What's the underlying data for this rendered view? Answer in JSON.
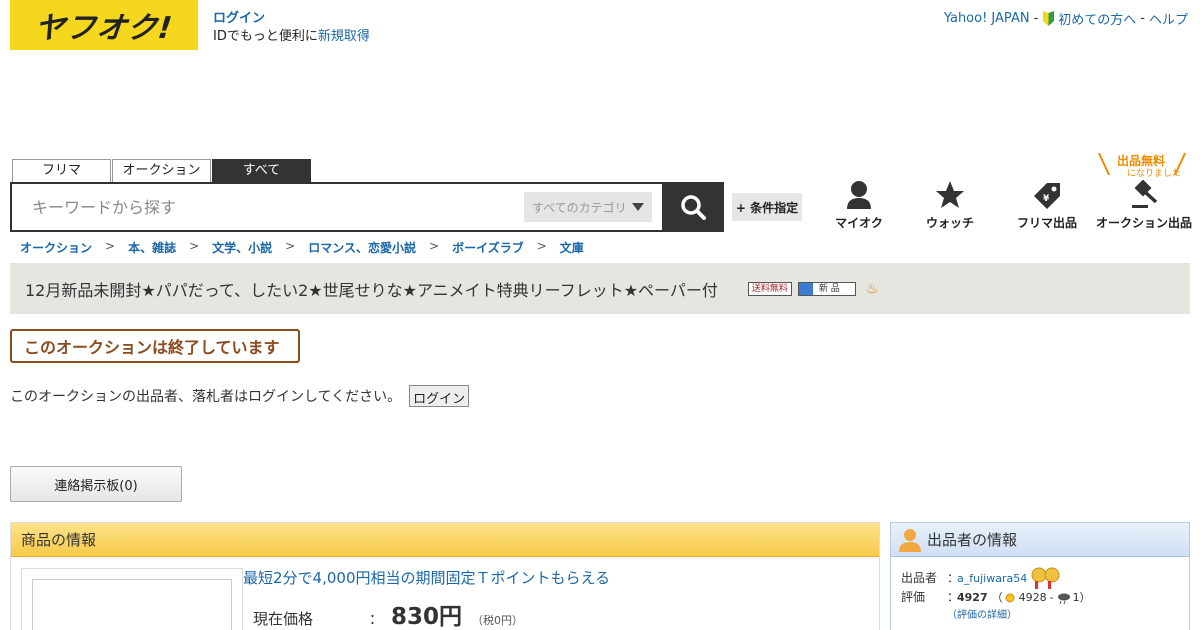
{
  "header": {
    "logo_text": "ヤフオク!",
    "login_label": "ログイン",
    "login_desc": "IDでもっと便利に",
    "signup_label": "新規取得",
    "links": {
      "yahoo_japan": "Yahoo! JAPAN",
      "beginner": "初めての方へ",
      "help": "ヘルプ",
      "sep": "-"
    }
  },
  "search": {
    "tabs": [
      "フリマ",
      "オークション",
      "すべて"
    ],
    "active_tab": 2,
    "placeholder": "キーワードから探す",
    "category": "すべてのカテゴリ",
    "condition_label": "+ 条件指定"
  },
  "nav": {
    "items": [
      "マイオク",
      "ウォッチ",
      "フリマ出品",
      "オークション出品"
    ],
    "free_badge_line1": "出品無料",
    "free_badge_line2": "になりました"
  },
  "breadcrumb": [
    "オークション",
    "本、雑誌",
    "文学、小説",
    "ロマンス、恋愛小説",
    "ボーイズラブ",
    "文庫"
  ],
  "breadcrumb_sep": ">",
  "listing": {
    "title": "12月新品未開封★パパだって、したい2★世尾せりな★アニメイト特典リーフレット★ペーパー付",
    "badge_shipping": "送料無料",
    "badge_new": "新 品",
    "ended_text": "このオークションは終了しています",
    "login_message": "このオークションの出品者、落札者はログインしてください。",
    "login_button": "ログイン",
    "board_button": "連絡掲示板(0)"
  },
  "product_info": {
    "header": "商品の情報",
    "promo": "最短2分で4,000円相当の期間固定Ｔポイントもらえる",
    "price_label": "現在価格",
    "colon": "：",
    "price": "830円",
    "tax": "（税0円）"
  },
  "seller_info": {
    "header": "出品者の情報",
    "seller_label": "出品者",
    "seller_name": "a_fujiwara54",
    "rating_label": "評価",
    "colon": "：",
    "rating_total": "4927",
    "rating_good": "4928",
    "rating_bad": "1",
    "open_paren": "（",
    "close_paren": "）",
    "dash": "-",
    "detail_link": "（評価の詳細）"
  },
  "colors": {
    "logo_yellow": "#f5d71e",
    "link_blue": "#1a67a8",
    "ended_brown": "#8a4b1e",
    "free_orange": "#f08c00"
  }
}
